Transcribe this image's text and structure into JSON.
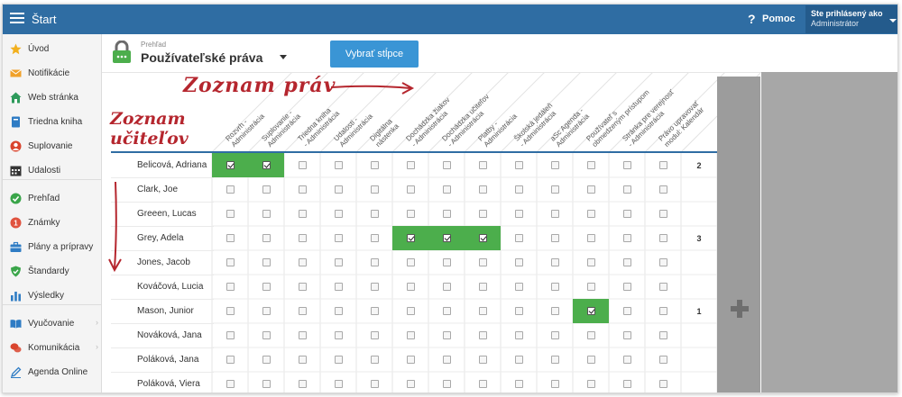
{
  "topbar": {
    "title": "Štart",
    "help_label": "Pomoc",
    "user_line1": "Ste prihlásený ako",
    "user_line2": "Administrátor"
  },
  "sidebar": {
    "items": [
      {
        "label": "Úvod",
        "icon": "star-icon",
        "color": "#f2b01e",
        "chevron": false
      },
      {
        "label": "Notifikácie",
        "icon": "envelope-icon",
        "color": "#f0a12a",
        "chevron": false
      },
      {
        "label": "Web stránka",
        "icon": "house-icon",
        "color": "#2e9a5b",
        "chevron": false
      },
      {
        "label": "Triedna kniha",
        "icon": "book-icon",
        "color": "#2f7cc4",
        "chevron": false
      },
      {
        "label": "Suplovanie",
        "icon": "person-icon",
        "color": "#d9442d",
        "chevron": false
      },
      {
        "label": "Udalosti",
        "icon": "calendar-icon",
        "color": "#333333",
        "chevron": false
      },
      {
        "label": "Prehľad",
        "icon": "check-circle-icon",
        "color": "#3aa54a",
        "chevron": false
      },
      {
        "label": "Známky",
        "icon": "grade-icon",
        "color": "#e0533f",
        "chevron": false
      },
      {
        "label": "Plány a prípravy",
        "icon": "briefcase-icon",
        "color": "#2f7cc4",
        "chevron": false
      },
      {
        "label": "Štandardy",
        "icon": "shield-icon",
        "color": "#3aa54a",
        "chevron": false
      },
      {
        "label": "Výsledky",
        "icon": "bar-chart-icon",
        "color": "#2f7cc4",
        "chevron": false
      },
      {
        "label": "Vyučovanie",
        "icon": "open-book-icon",
        "color": "#2f7cc4",
        "chevron": true
      },
      {
        "label": "Komunikácia",
        "icon": "chat-icon",
        "color": "#d9442d",
        "chevron": true
      },
      {
        "label": "Agenda Online",
        "icon": "pen-icon",
        "color": "#2f7cc4",
        "chevron": false
      }
    ]
  },
  "header": {
    "breadcrumb": "Prehľad",
    "title": "Používateľské práva",
    "select_columns_label": "Vybrať stĺpce"
  },
  "annotations": {
    "rights": "Zoznam práv",
    "teachers_line1": "Zoznam",
    "teachers_line2": "učiteľov"
  },
  "columns": [
    {
      "line1": "Rozvrh -",
      "line2": "Administrácia"
    },
    {
      "line1": "Suplovanie -",
      "line2": "Administrácia"
    },
    {
      "line1": "Triedna kniha",
      "line2": "- Administrácia"
    },
    {
      "line1": "Udalosti -",
      "line2": "Administrácia"
    },
    {
      "line1": "Digitálna",
      "line2": "nástenka"
    },
    {
      "line1": "Dochádzka žiakov",
      "line2": "- Administrácia"
    },
    {
      "line1": "Dochádzka učiteľov",
      "line2": "- Administrácia"
    },
    {
      "line1": "Platby -",
      "line2": "Administrácia"
    },
    {
      "line1": "Školská jedáleň",
      "line2": "- Administrácia"
    },
    {
      "line1": "aSc Agenda -",
      "line2": "Administrácia"
    },
    {
      "line1": "Používateľ s",
      "line2": "obmedzeným prístupom"
    },
    {
      "line1": "Stránka pre verejnosť",
      "line2": "- Administrácia"
    },
    {
      "line1": "Právo upravovať",
      "line2": "modul: Kalendár"
    }
  ],
  "rows": [
    {
      "name": "Belicová, Adriana",
      "checked": [
        0,
        1
      ],
      "count": "2"
    },
    {
      "name": "Clark, Joe",
      "checked": [],
      "count": ""
    },
    {
      "name": "Greeen, Lucas",
      "checked": [],
      "count": ""
    },
    {
      "name": "Grey, Adela",
      "checked": [
        5,
        6,
        7
      ],
      "count": "3"
    },
    {
      "name": "Jones, Jacob",
      "checked": [],
      "count": ""
    },
    {
      "name": "Kováčová, Lucia",
      "checked": [],
      "count": ""
    },
    {
      "name": "Mason, Junior",
      "checked": [
        10
      ],
      "count": "1"
    },
    {
      "name": "Nováková, Jana",
      "checked": [],
      "count": ""
    },
    {
      "name": "Poláková, Jana",
      "checked": [],
      "count": ""
    },
    {
      "name": "Poláková, Viera",
      "checked": [],
      "count": ""
    }
  ]
}
